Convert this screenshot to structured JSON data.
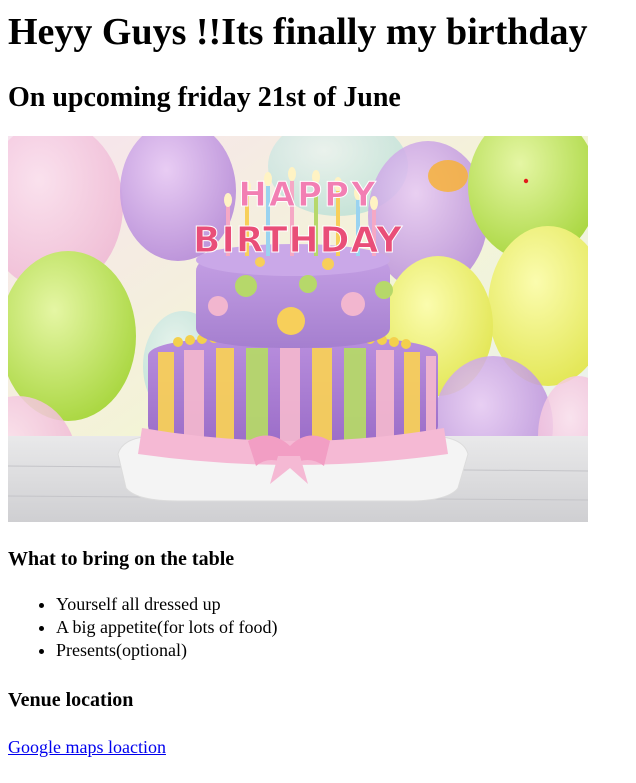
{
  "page": {
    "title": "Heyy Guys !!Its finally my birthday",
    "subtitle": "On upcoming friday 21st of June",
    "image": {
      "banner_text_line1": "HAPPY",
      "banner_text_line2": "BIRTHDAY"
    },
    "bring_heading": "What to bring on the table",
    "bring_items": [
      "Yourself all dressed up",
      "A big appetite(for lots of food)",
      "Presents(optional)"
    ],
    "venue_heading": "Venue location",
    "map_link_label": "Google maps loaction"
  },
  "colors": {
    "link": "#0000ee",
    "text": "#000000",
    "background": "#ffffff"
  }
}
